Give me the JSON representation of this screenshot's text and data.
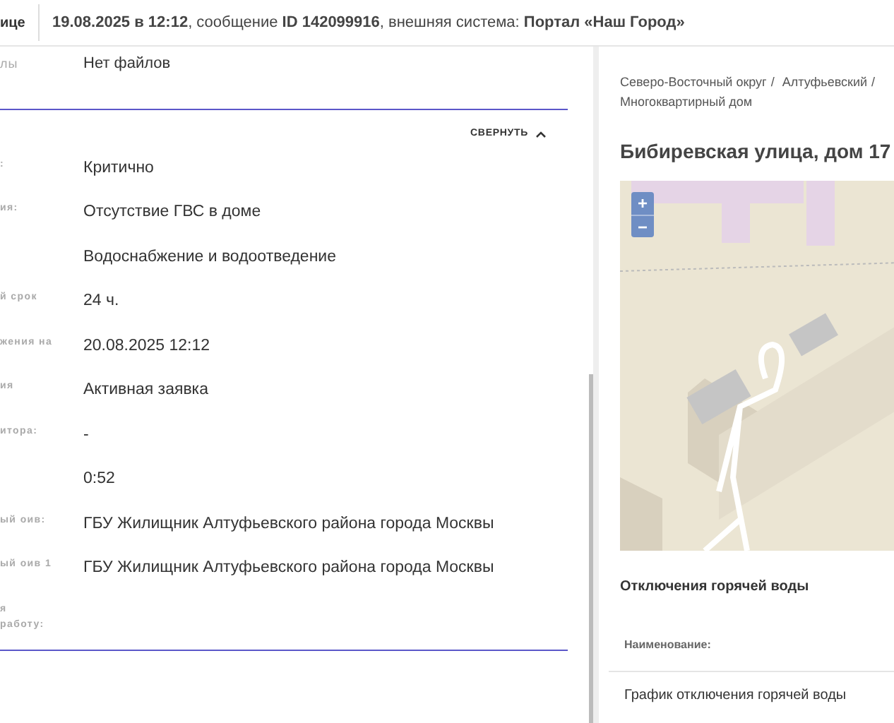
{
  "header": {
    "label": "ице",
    "date": "19.08.2025 в 12:12",
    "sep1": ", сообщение ",
    "id": "ID 142099916",
    "sep2": ", внешняя система: ",
    "system": "Портал «Наш Город»"
  },
  "files": {
    "label": "лы",
    "value": "Нет файлов"
  },
  "collapse": {
    "label": "СВЕРНУТЬ",
    "expanded": true
  },
  "fields": [
    {
      "label": ":",
      "value": "Критично"
    },
    {
      "label": "ия:",
      "value": "Отсутствие ГВС в доме"
    },
    {
      "value": "Водоснабжение и водоотведение"
    },
    {
      "label": "й срок",
      "value": "24 ч."
    },
    {
      "label": "жения на",
      "value": "20.08.2025 12:12"
    },
    {
      "label": "ия",
      "value": "Активная заявка"
    },
    {
      "label": "итора:",
      "value": "-"
    },
    {
      "value": "0:52"
    },
    {
      "label": "ый оив:",
      "value": "ГБУ Жилищник Алтуфьевского района города Москвы"
    },
    {
      "label": "ый оив 1",
      "value": "ГБУ Жилищник Алтуфьевского района города Москвы"
    },
    {
      "label": "я\nработу:"
    }
  ],
  "breadcrumb": {
    "separator": "/",
    "items": [
      "Северо-Восточный округ",
      "Алтуфьевский",
      "Многоквартирный дом"
    ]
  },
  "address": "Бибиревская улица, дом 17",
  "map": {
    "zoom_in": "+",
    "zoom_out": "−"
  },
  "outages": {
    "title": "Отключения горячей воды",
    "column": "Наименование:",
    "rows": [
      "График отключения горячей воды"
    ]
  }
}
